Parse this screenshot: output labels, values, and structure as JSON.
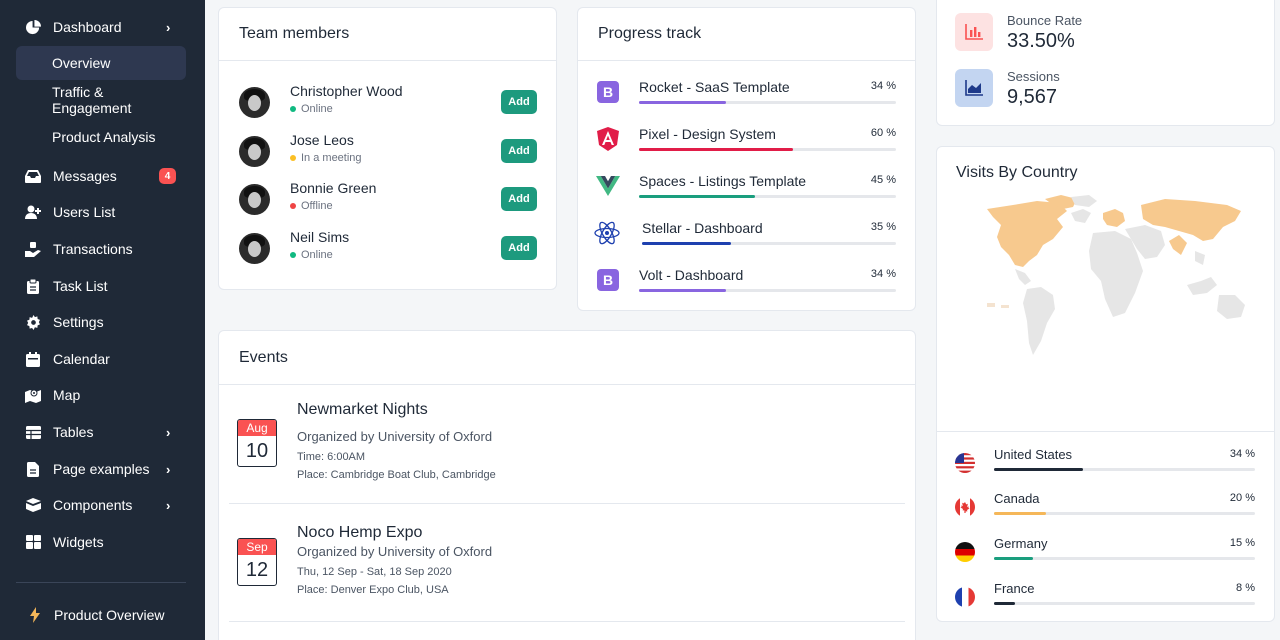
{
  "sidebar": {
    "items": [
      {
        "label": "Dashboard",
        "icon": "pie-chart-icon"
      },
      {
        "label": "Overview"
      },
      {
        "label": "Traffic & Engagement"
      },
      {
        "label": "Product Analysis"
      },
      {
        "label": "Messages",
        "icon": "inbox-icon",
        "badge": "4"
      },
      {
        "label": "Users List",
        "icon": "user-add-icon"
      },
      {
        "label": "Transactions",
        "icon": "cash-icon"
      },
      {
        "label": "Task List",
        "icon": "clipboard-icon"
      },
      {
        "label": "Settings",
        "icon": "gear-icon"
      },
      {
        "label": "Calendar",
        "icon": "calendar-icon"
      },
      {
        "label": "Map",
        "icon": "map-icon"
      },
      {
        "label": "Tables",
        "icon": "table-icon"
      },
      {
        "label": "Page examples",
        "icon": "document-icon"
      },
      {
        "label": "Components",
        "icon": "archive-icon"
      },
      {
        "label": "Widgets",
        "icon": "grid-icon"
      }
    ],
    "footer": {
      "label": "Product Overview",
      "icon": "lightning-icon"
    }
  },
  "team": {
    "title": "Team members",
    "add_label": "Add",
    "members": [
      {
        "name": "Christopher Wood",
        "status": "Online",
        "status_color": "#10b981"
      },
      {
        "name": "Jose Leos",
        "status": "In a meeting",
        "status_color": "#fbbf24"
      },
      {
        "name": "Bonnie Green",
        "status": "Offline",
        "status_color": "#ef4444"
      },
      {
        "name": "Neil Sims",
        "status": "Online",
        "status_color": "#10b981"
      }
    ]
  },
  "progress": {
    "title": "Progress track",
    "items": [
      {
        "name": "Rocket - SaaS Template",
        "pct_label": "34 %",
        "value": 34,
        "color": "#8965e0",
        "icon": "bootstrap-icon"
      },
      {
        "name": "Pixel - Design System",
        "pct_label": "60 %",
        "value": 60,
        "color": "#e11d48",
        "icon": "angular-icon"
      },
      {
        "name": "Spaces - Listings Template",
        "pct_label": "45 %",
        "value": 45,
        "color": "#1a9e7e",
        "icon": "vue-icon"
      },
      {
        "name": "Stellar - Dashboard",
        "pct_label": "35 %",
        "value": 35,
        "color": "#1e40af",
        "icon": "react-icon"
      },
      {
        "name": "Volt - Dashboard",
        "pct_label": "34 %",
        "value": 34,
        "color": "#8965e0",
        "icon": "bootstrap-icon"
      }
    ]
  },
  "stats": [
    {
      "label": "Bounce Rate",
      "value": "33.50%",
      "icon": "bar-chart-icon",
      "bg": "#fde2e2",
      "fg": "#fa5252"
    },
    {
      "label": "Sessions",
      "value": "9,567",
      "icon": "area-chart-icon",
      "bg": "#c3d5f1",
      "fg": "#1e3a8a"
    }
  ],
  "visits": {
    "title": "Visits By Country",
    "countries": [
      {
        "name": "United States",
        "pct_label": "34 %",
        "value": 34,
        "color": "#1f2937",
        "flag": "us-flag-icon"
      },
      {
        "name": "Canada",
        "pct_label": "20 %",
        "value": 20,
        "color": "#f5b759",
        "flag": "canada-flag-icon"
      },
      {
        "name": "Germany",
        "pct_label": "15 %",
        "value": 15,
        "color": "#1a9e7e",
        "flag": "germany-flag-icon"
      },
      {
        "name": "France",
        "pct_label": "8 %",
        "value": 8,
        "color": "#1f2937",
        "flag": "france-flag-icon"
      }
    ]
  },
  "events": {
    "title": "Events",
    "items": [
      {
        "month": "Aug",
        "day": "10",
        "title": "Newmarket Nights",
        "org": "Organized by University of Oxford",
        "line1": "Time: 6:00AM",
        "line2": "Place: Cambridge Boat Club, Cambridge"
      },
      {
        "month": "Sep",
        "day": "12",
        "title": "Noco Hemp Expo",
        "org": "Organized by University of Oxford",
        "line1": "Thu, 12 Sep - Sat, 18 Sep 2020",
        "line2": "Place: Denver Expo Club, USA"
      }
    ]
  }
}
